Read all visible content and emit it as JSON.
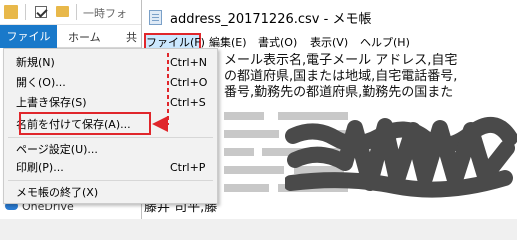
{
  "explorer": {
    "title": "一時フォ",
    "ribbon": {
      "file": "ファイル",
      "home": "ホーム",
      "share": "共"
    },
    "nav_item": "OneDrive"
  },
  "notepad": {
    "title": "address_20171226.csv - メモ帳",
    "menubar": [
      "ファイル(F)",
      "編集(E)",
      "書式(O)",
      "表示(V)",
      "ヘルプ(H)"
    ],
    "text_lines": [
      "メール表示名,電子メール アドレス,自宅",
      "の都道府県,国または地域,自宅電話番号,",
      "番号,勤務先の都道府県,勤務先の国また",
      "",
      "",
      "",
      "",
      "",
      "藤井 司平,藤"
    ]
  },
  "file_menu": {
    "items": [
      {
        "label": "新規(N)",
        "shortcut": "Ctrl+N"
      },
      {
        "label": "開く(O)...",
        "shortcut": "Ctrl+O"
      },
      {
        "label": "上書き保存(S)",
        "shortcut": "Ctrl+S"
      },
      {
        "label": "名前を付けて保存(A)...",
        "shortcut": ""
      },
      {
        "label": "ページ設定(U)...",
        "shortcut": ""
      },
      {
        "label": "印刷(P)...",
        "shortcut": "Ctrl+P"
      },
      {
        "label": "メモ帳の終了(X)",
        "shortcut": ""
      }
    ]
  },
  "colors": {
    "highlight": "#e0262b",
    "ribbon_file": "#1979ca",
    "menu_active": "#cce8ff"
  }
}
